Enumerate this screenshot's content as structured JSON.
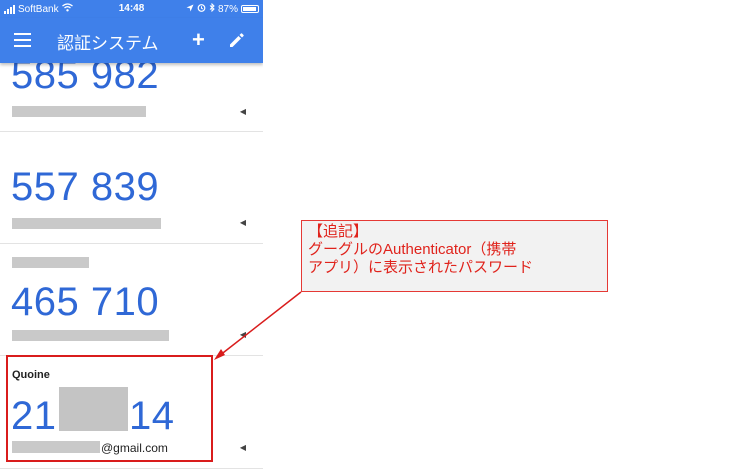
{
  "status_bar": {
    "carrier": "SoftBank",
    "time": "14:48",
    "battery": "87%"
  },
  "app_bar": {
    "title": "認証システム",
    "menu_icon": "hamburger-menu-icon",
    "add_icon": "plus-icon",
    "edit_icon": "pencil-icon"
  },
  "entries": [
    {
      "code": "585 982"
    },
    {
      "code": "557 839"
    },
    {
      "code": "465 710"
    },
    {
      "name": "Quoine",
      "code_start": "21",
      "code_end": "14",
      "account_suffix": "@gmail.com"
    }
  ],
  "callout": {
    "line1": "【追記】",
    "line2": "グーグルのAuthenticator（携帯",
    "line3": "アプリ）に表示されたパスワード"
  },
  "colors": {
    "app_bar": "#3f80ea",
    "code": "#2f68d6",
    "annotation_red": "#d91c1c"
  }
}
